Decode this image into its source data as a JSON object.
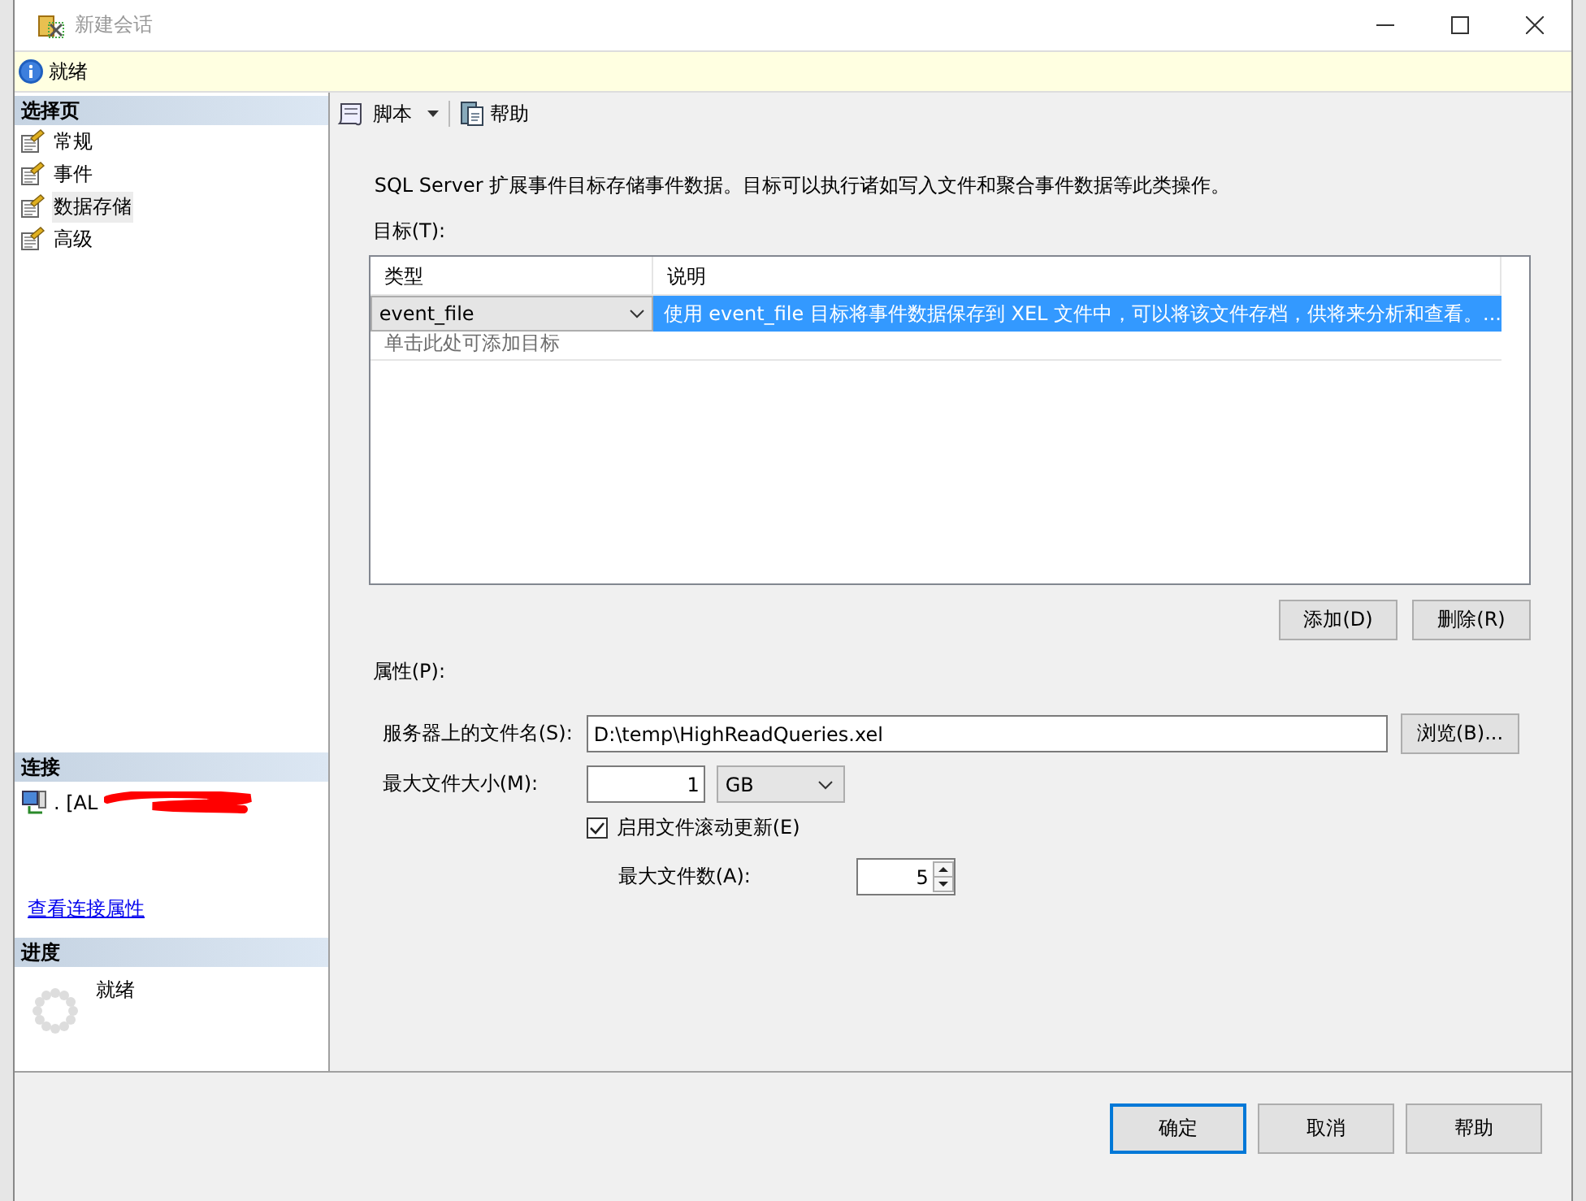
{
  "window": {
    "title": "新建会话"
  },
  "info_bar": {
    "status": "就绪"
  },
  "sidebar": {
    "pages_header": "选择页",
    "pages": [
      {
        "label": "常规",
        "selected": false
      },
      {
        "label": "事件",
        "selected": false
      },
      {
        "label": "数据存储",
        "selected": true
      },
      {
        "label": "高级",
        "selected": false
      }
    ],
    "connection_header": "连接",
    "connection": ". [AL",
    "connection_link": "查看连接属性",
    "progress_header": "进度",
    "progress_status": "就绪"
  },
  "toolbar": {
    "items": [
      {
        "label": "脚本",
        "kind": "dropdown"
      },
      {
        "label": "帮助",
        "kind": "button"
      }
    ]
  },
  "description": "SQL Server 扩展事件目标存储事件数据。目标可以执行诸如写入文件和聚合事件数据等此类操作。",
  "targets": {
    "label": "目标(T):",
    "columns": [
      "类型",
      "说明"
    ],
    "rows": [
      {
        "type": "event_file",
        "description": "使用 event_file 目标将事件数据保存到 XEL 文件中，可以将该文件存档，供将来分析和查看。...",
        "selected": true
      }
    ],
    "placeholder": "单击此处可添加目标",
    "buttons": [
      "添加(D)",
      "删除(R)"
    ]
  },
  "properties": {
    "label": "属性(P):",
    "file_name": {
      "label": "服务器上的文件名(S):",
      "value": "D:\\temp\\HighReadQueries.xel",
      "button": "浏览(B)..."
    },
    "max_file_size": {
      "label": "最大文件大小(M):",
      "value": "1",
      "unit": "GB"
    },
    "rollover": {
      "label": "启用文件滚动更新(E)",
      "checked": true
    },
    "max_files": {
      "label": "最大文件数(A):",
      "value": "5"
    }
  },
  "footer": {
    "buttons": [
      {
        "label": "确定",
        "default": true
      },
      {
        "label": "取消",
        "default": false
      },
      {
        "label": "帮助",
        "default": false
      }
    ]
  }
}
